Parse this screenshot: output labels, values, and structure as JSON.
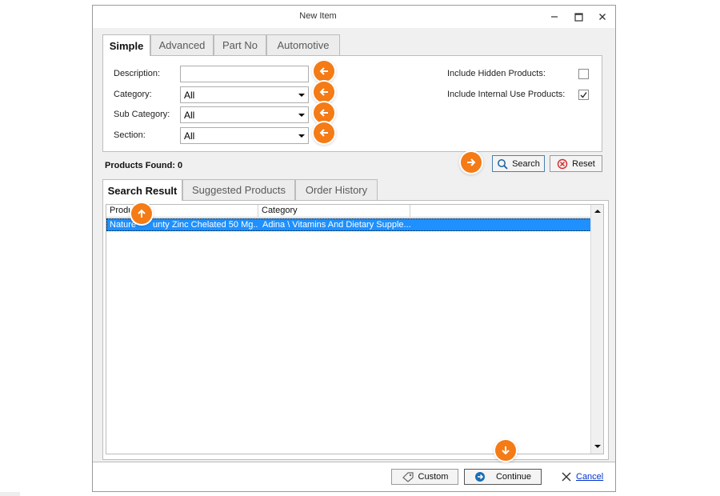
{
  "window": {
    "title": "New Item"
  },
  "search_tabs": [
    {
      "label": "Simple",
      "active": true
    },
    {
      "label": "Advanced",
      "active": false
    },
    {
      "label": "Part No",
      "active": false
    },
    {
      "label": "Automotive",
      "active": false
    }
  ],
  "form": {
    "description_label": "Description:",
    "description_value": "",
    "category_label": "Category:",
    "category_value": "All",
    "subcategory_label": "Sub Category:",
    "subcategory_value": "All",
    "section_label": "Section:",
    "section_value": "All",
    "hidden_products_label": "Include Hidden Products:",
    "hidden_products_checked": false,
    "internal_use_label": "Include Internal Use Products:",
    "internal_use_checked": true
  },
  "status": {
    "products_found": "Products Found: 0"
  },
  "buttons": {
    "search": "Search",
    "reset": "Reset",
    "custom": "Custom",
    "continue": "Continue",
    "cancel": "Cancel"
  },
  "result_tabs": [
    {
      "label": "Search Result",
      "active": true
    },
    {
      "label": "Suggested Products",
      "active": false
    },
    {
      "label": "Order History",
      "active": false
    }
  ],
  "grid": {
    "columns": [
      "Produ",
      "Category"
    ],
    "rows": [
      {
        "product": "Nature",
        "product_tail": "unty Zinc Chelated 50 Mg...",
        "category": "Adina \\ Vitamins And Dietary Supple..."
      }
    ]
  },
  "colors": {
    "accent_orange": "#f47b16",
    "selection_blue": "#1e90ff"
  },
  "icons": [
    "minimize-icon",
    "maximize-icon",
    "close-icon",
    "arrow-left-icon",
    "arrow-right-icon",
    "arrow-up-icon",
    "arrow-down-icon",
    "magnifier-icon",
    "reset-icon",
    "tag-icon",
    "continue-icon",
    "cancel-x-icon"
  ]
}
